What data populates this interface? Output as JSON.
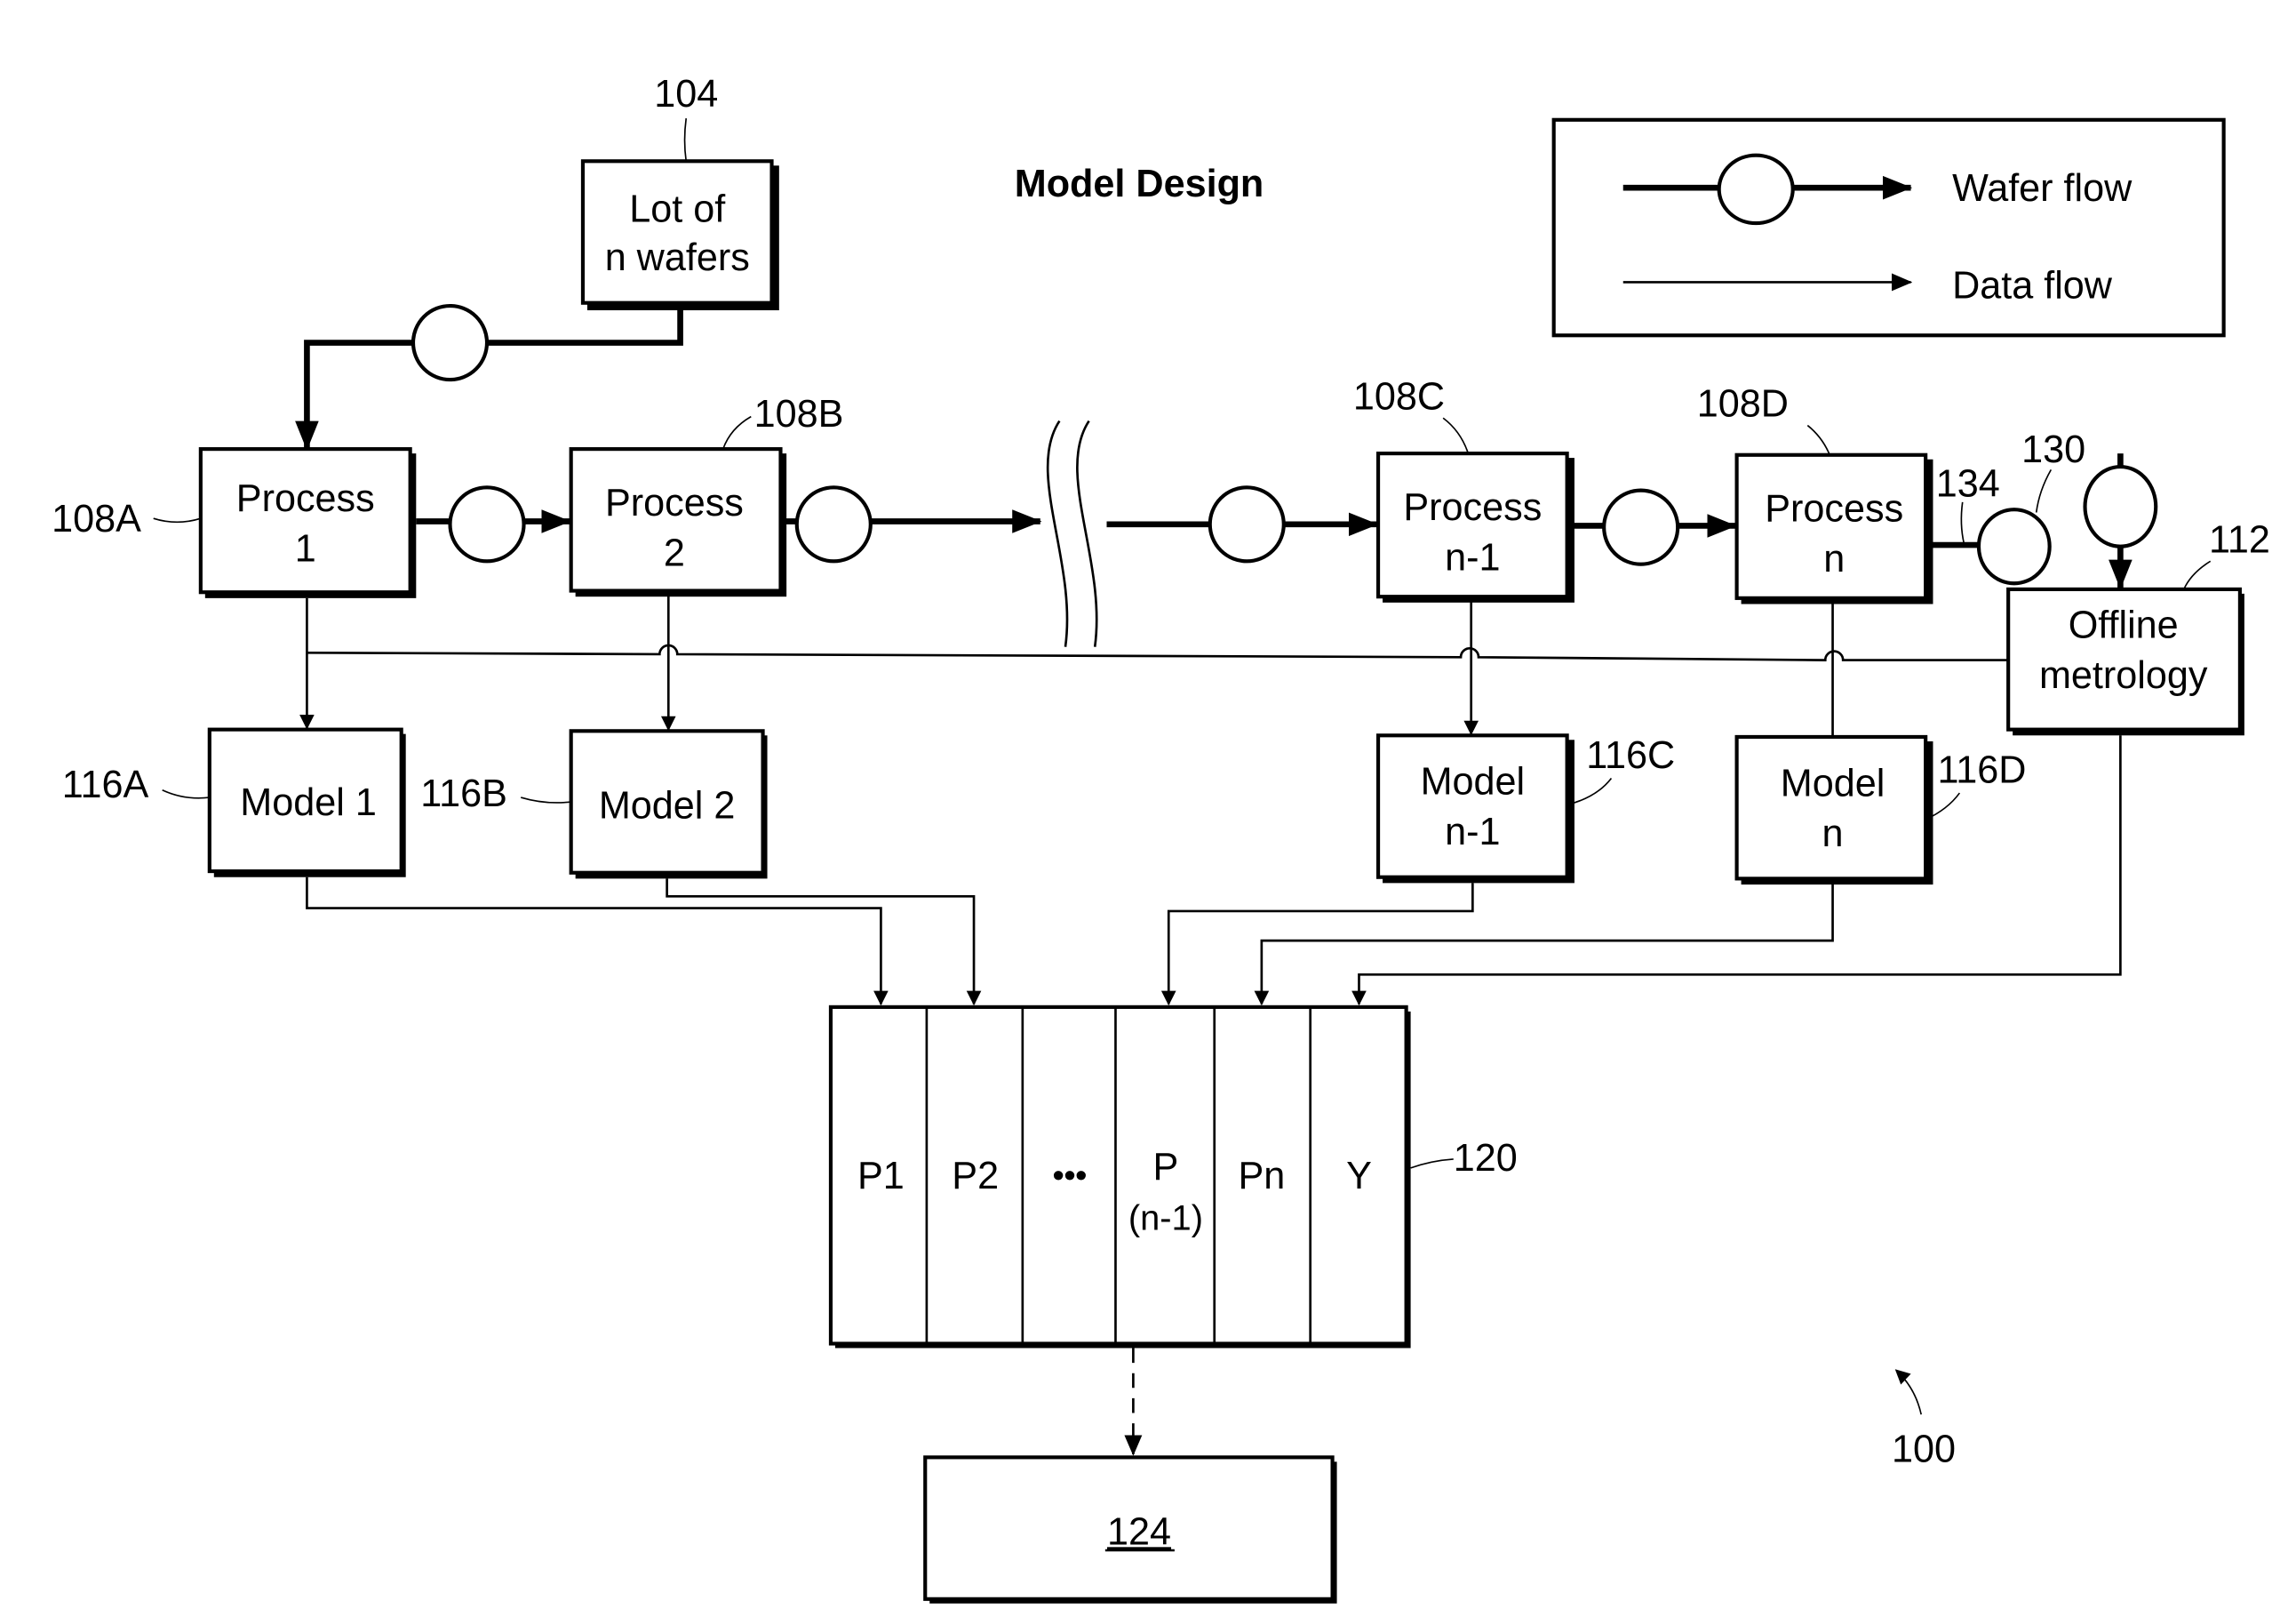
{
  "title": "Model Design",
  "figure_ref": "100",
  "legend": {
    "wafer_flow": "Wafer flow",
    "data_flow": "Data flow"
  },
  "lot": {
    "ref": "104",
    "line1": "Lot of",
    "line2": "n wafers"
  },
  "processes": [
    {
      "ref": "108A",
      "line1": "Process",
      "line2": "1"
    },
    {
      "ref": "108B",
      "line1": "Process",
      "line2": "2"
    },
    {
      "ref": "108C",
      "line1": "Process",
      "line2": "n-1"
    },
    {
      "ref": "108D",
      "line1": "Process",
      "line2": "n"
    }
  ],
  "models": [
    {
      "ref": "116A",
      "line1": "Model 1",
      "line2": ""
    },
    {
      "ref": "116B",
      "line1": "Model 2",
      "line2": ""
    },
    {
      "ref": "116C",
      "line1": "Model",
      "line2": "n-1"
    },
    {
      "ref": "116D",
      "line1": "Model",
      "line2": "n"
    }
  ],
  "metrology": {
    "ref": "112",
    "line1": "Offline",
    "line2": "metrology"
  },
  "wafer_refs": {
    "line": "134",
    "circle": "130"
  },
  "table": {
    "ref": "120",
    "columns": [
      "P1",
      "P2",
      "•••",
      "P",
      "Pn",
      "Y"
    ],
    "col4_sub": "(n-1)"
  },
  "output_box": {
    "ref": "124"
  }
}
